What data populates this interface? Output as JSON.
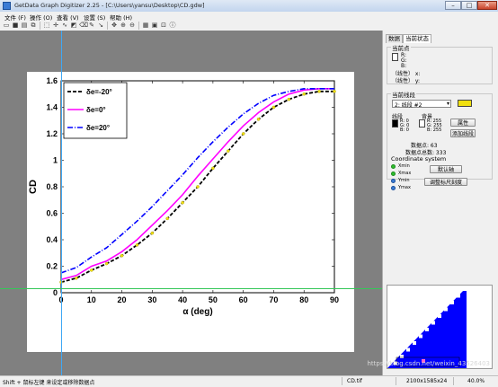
{
  "window": {
    "title": "GetData Graph Digitizer 2.25 - [C:\\Users\\yansu\\Desktop\\CD.gdw]",
    "buttons": {
      "minimize": "–",
      "maximize": "□",
      "close": "✕"
    }
  },
  "menu": [
    "文件 (F)",
    "操作 (O)",
    "查看 (V)",
    "设置 (S)",
    "帮助 (H)"
  ],
  "toolbar_icons": [
    "open-icon",
    "save-icon",
    "print-icon",
    "copy-icon",
    "select-icon",
    "point-icon",
    "line-icon",
    "area-icon",
    "eraser-icon",
    "pencil-icon",
    "arrow-icon",
    "move-icon",
    "zoom-in-icon",
    "zoom-out-icon",
    "grid-icon",
    "image-icon",
    "fit-icon",
    "info-icon"
  ],
  "side": {
    "tabs": [
      "数据",
      "当前状态"
    ],
    "current_point": {
      "label": "当前点",
      "r": "R:",
      "g": "G:",
      "b": "B:",
      "x_line": "（线性） x:",
      "y_line": "（线性） y:"
    },
    "current_line": {
      "label": "当前线段",
      "select": "2: 线段 #2",
      "line_label": "线段",
      "bg_label": "背景",
      "line_rgb": [
        "R: 0",
        "G: 0",
        "B: 0"
      ],
      "bg_rgb": [
        "R: 255",
        "G: 255",
        "B: 255"
      ],
      "props_btn": "属性",
      "add_btn": "添加线段",
      "points": "数据点: 63",
      "total": "数据点总数: 333",
      "color_line": "#000000",
      "color_bg": "#ffffff",
      "color_marker": "#f0e010"
    },
    "coord": {
      "label": "Coordinate system",
      "items": [
        "Xmin",
        "Xmax",
        "Ymin",
        "Ymax"
      ],
      "default_btn": "默认轴",
      "adjust_btn": "调整标尺刻度"
    }
  },
  "status": {
    "hint": "Shift + 鼠标左键 来设定或移除数据点",
    "file": "CD.tif",
    "size": "2100x1585x24",
    "zoom": "40.0%"
  },
  "watermark": "https://blog.csdn.net/weixin_43526403",
  "chart_data": {
    "type": "line",
    "xlabel": "α (deg)",
    "ylabel": "C_D",
    "xlim": [
      0,
      90
    ],
    "ylim": [
      0,
      1.6
    ],
    "xticks": [
      0,
      10,
      20,
      30,
      40,
      50,
      60,
      70,
      80,
      90
    ],
    "yticks": [
      0,
      0.2,
      0.4,
      0.6,
      0.8,
      1,
      1.2,
      1.4,
      1.6
    ],
    "legend_position": "top-left",
    "series": [
      {
        "name": "δe=-20°",
        "color": "#000000",
        "style": "dashed-black-with-yellow-markers",
        "x": [
          0,
          5,
          10,
          15,
          20,
          25,
          30,
          35,
          40,
          45,
          50,
          55,
          60,
          65,
          70,
          75,
          80,
          85,
          90
        ],
        "y": [
          0.08,
          0.11,
          0.17,
          0.22,
          0.28,
          0.36,
          0.45,
          0.56,
          0.68,
          0.8,
          0.94,
          1.07,
          1.2,
          1.31,
          1.4,
          1.46,
          1.5,
          1.52,
          1.52
        ]
      },
      {
        "name": "δe=0°",
        "color": "#ff00ff",
        "style": "solid",
        "x": [
          0,
          5,
          10,
          15,
          20,
          25,
          30,
          35,
          40,
          45,
          50,
          55,
          60,
          65,
          70,
          75,
          80,
          85,
          90
        ],
        "y": [
          0.1,
          0.13,
          0.2,
          0.24,
          0.31,
          0.4,
          0.51,
          0.62,
          0.74,
          0.88,
          1.01,
          1.14,
          1.26,
          1.36,
          1.44,
          1.5,
          1.53,
          1.54,
          1.54
        ]
      },
      {
        "name": "δe=20°",
        "color": "#0000ff",
        "style": "dash-dot",
        "x": [
          0,
          5,
          10,
          15,
          20,
          25,
          30,
          35,
          40,
          45,
          50,
          55,
          60,
          65,
          70,
          75,
          80,
          85,
          90
        ],
        "y": [
          0.15,
          0.19,
          0.27,
          0.34,
          0.44,
          0.54,
          0.65,
          0.77,
          0.89,
          1.02,
          1.14,
          1.25,
          1.35,
          1.43,
          1.49,
          1.52,
          1.54,
          1.54,
          1.54
        ]
      }
    ]
  }
}
